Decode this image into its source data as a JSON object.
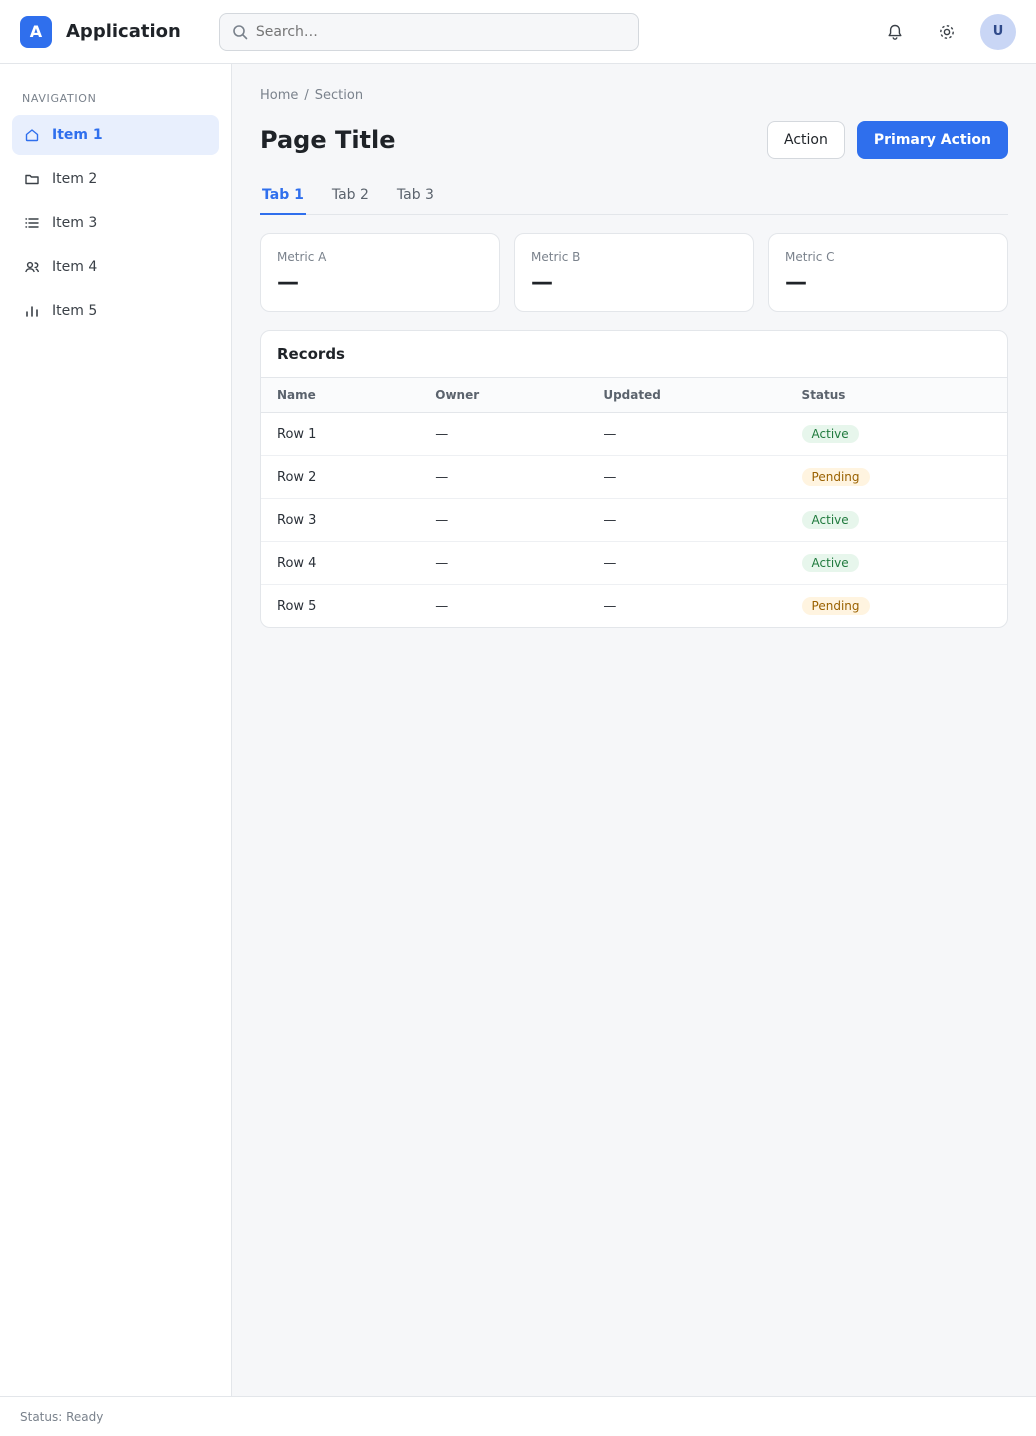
{
  "app": {
    "title": "Application",
    "logo_text": "A"
  },
  "search": {
    "placeholder": "Search…"
  },
  "header": {
    "user_initials": "U"
  },
  "sidebar": {
    "section_label": "Navigation",
    "items": [
      {
        "label": "Item 1",
        "badge": ""
      },
      {
        "label": "Item 2",
        "badge": ""
      },
      {
        "label": "Item 3",
        "badge": ""
      },
      {
        "label": "Item 4",
        "badge": ""
      },
      {
        "label": "Item 5",
        "badge": ""
      }
    ]
  },
  "main": {
    "breadcrumb": [
      "Home",
      "Section"
    ],
    "title": "Page Title",
    "secondary_button": "Action",
    "primary_button": "Primary Action",
    "tabs": [
      "Tab 1",
      "Tab 2",
      "Tab 3"
    ],
    "cards": [
      {
        "label": "Metric A",
        "value": "—"
      },
      {
        "label": "Metric B",
        "value": "—"
      },
      {
        "label": "Metric C",
        "value": "—"
      }
    ],
    "panel_title": "Records",
    "table": {
      "columns": [
        "Name",
        "Owner",
        "Updated",
        "Status"
      ],
      "rows": [
        [
          "Row 1",
          "—",
          "—",
          "Active"
        ],
        [
          "Row 2",
          "—",
          "—",
          "Pending"
        ],
        [
          "Row 3",
          "—",
          "—",
          "Active"
        ],
        [
          "Row 4",
          "—",
          "—",
          "Active"
        ],
        [
          "Row 5",
          "—",
          "—",
          "Pending"
        ]
      ]
    }
  },
  "footer": {
    "text": "Status: Ready"
  }
}
